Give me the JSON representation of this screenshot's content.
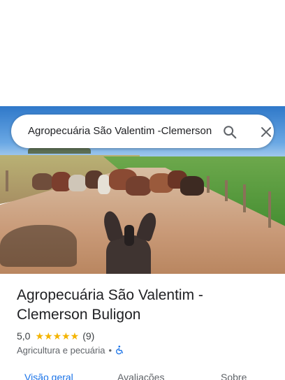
{
  "search": {
    "query": "Agropecuária São Valentim -Clemerson Buligon"
  },
  "place": {
    "name": "Agropecuária São Valentim - Clemerson Buligon",
    "rating": "5,0",
    "stars": "★★★★★",
    "review_count": "(9)",
    "category": "Agricultura e pecuária",
    "separator": "•"
  },
  "tabs": [
    {
      "label": "Visão geral"
    },
    {
      "label": "Avaliações"
    },
    {
      "label": "Sobre"
    }
  ],
  "icons": {
    "search": "search-icon",
    "close": "close-icon",
    "accessibility": "wheelchair-icon"
  },
  "colors": {
    "accent": "#1a73e8",
    "star": "#f4b400",
    "text_primary": "#202124",
    "text_secondary": "#5f6368"
  }
}
